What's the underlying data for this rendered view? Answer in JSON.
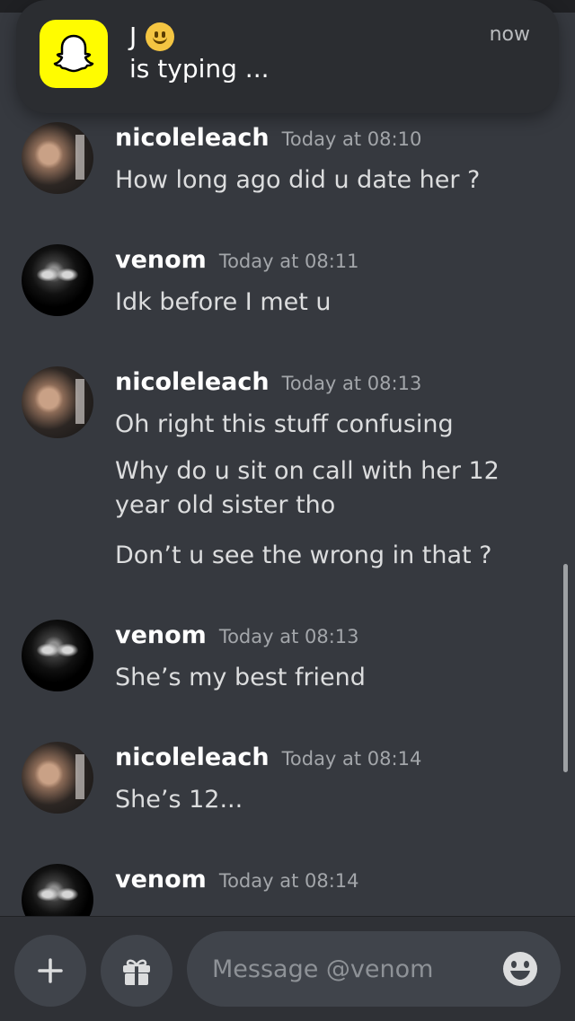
{
  "notification": {
    "app_icon": "snapchat-ghost-icon",
    "title": "J",
    "emoji": "slightly-smiling-face-icon",
    "subtitle": "is typing ...",
    "time": "now"
  },
  "messages": [
    {
      "user": "nicoleleach",
      "time": "Today at 08:10",
      "lines": [
        "How long ago did u date her ?"
      ]
    },
    {
      "user": "venom",
      "time": "Today at 08:11",
      "lines": [
        "Idk before I met u"
      ]
    },
    {
      "user": "nicoleleach",
      "time": "Today at 08:13",
      "lines": [
        "Oh right this stuff confusing",
        "Why do u sit on call with her 12 year old sister tho",
        "Don’t u see the wrong in that ?"
      ]
    },
    {
      "user": "venom",
      "time": "Today at 08:13",
      "lines": [
        "She’s my best friend"
      ]
    },
    {
      "user": "nicoleleach",
      "time": "Today at 08:14",
      "lines": [
        "She’s 12..."
      ]
    },
    {
      "user": "venom",
      "time": "Today at 08:14",
      "lines": []
    }
  ],
  "composer": {
    "placeholder": "Message @venom",
    "add_icon": "plus-icon",
    "gift_icon": "gift-icon",
    "emoji_icon": "emoji-icon"
  },
  "colors": {
    "background": "#36393f",
    "composer_bg": "#2f3136",
    "snapchat_yellow": "#fffc00"
  }
}
